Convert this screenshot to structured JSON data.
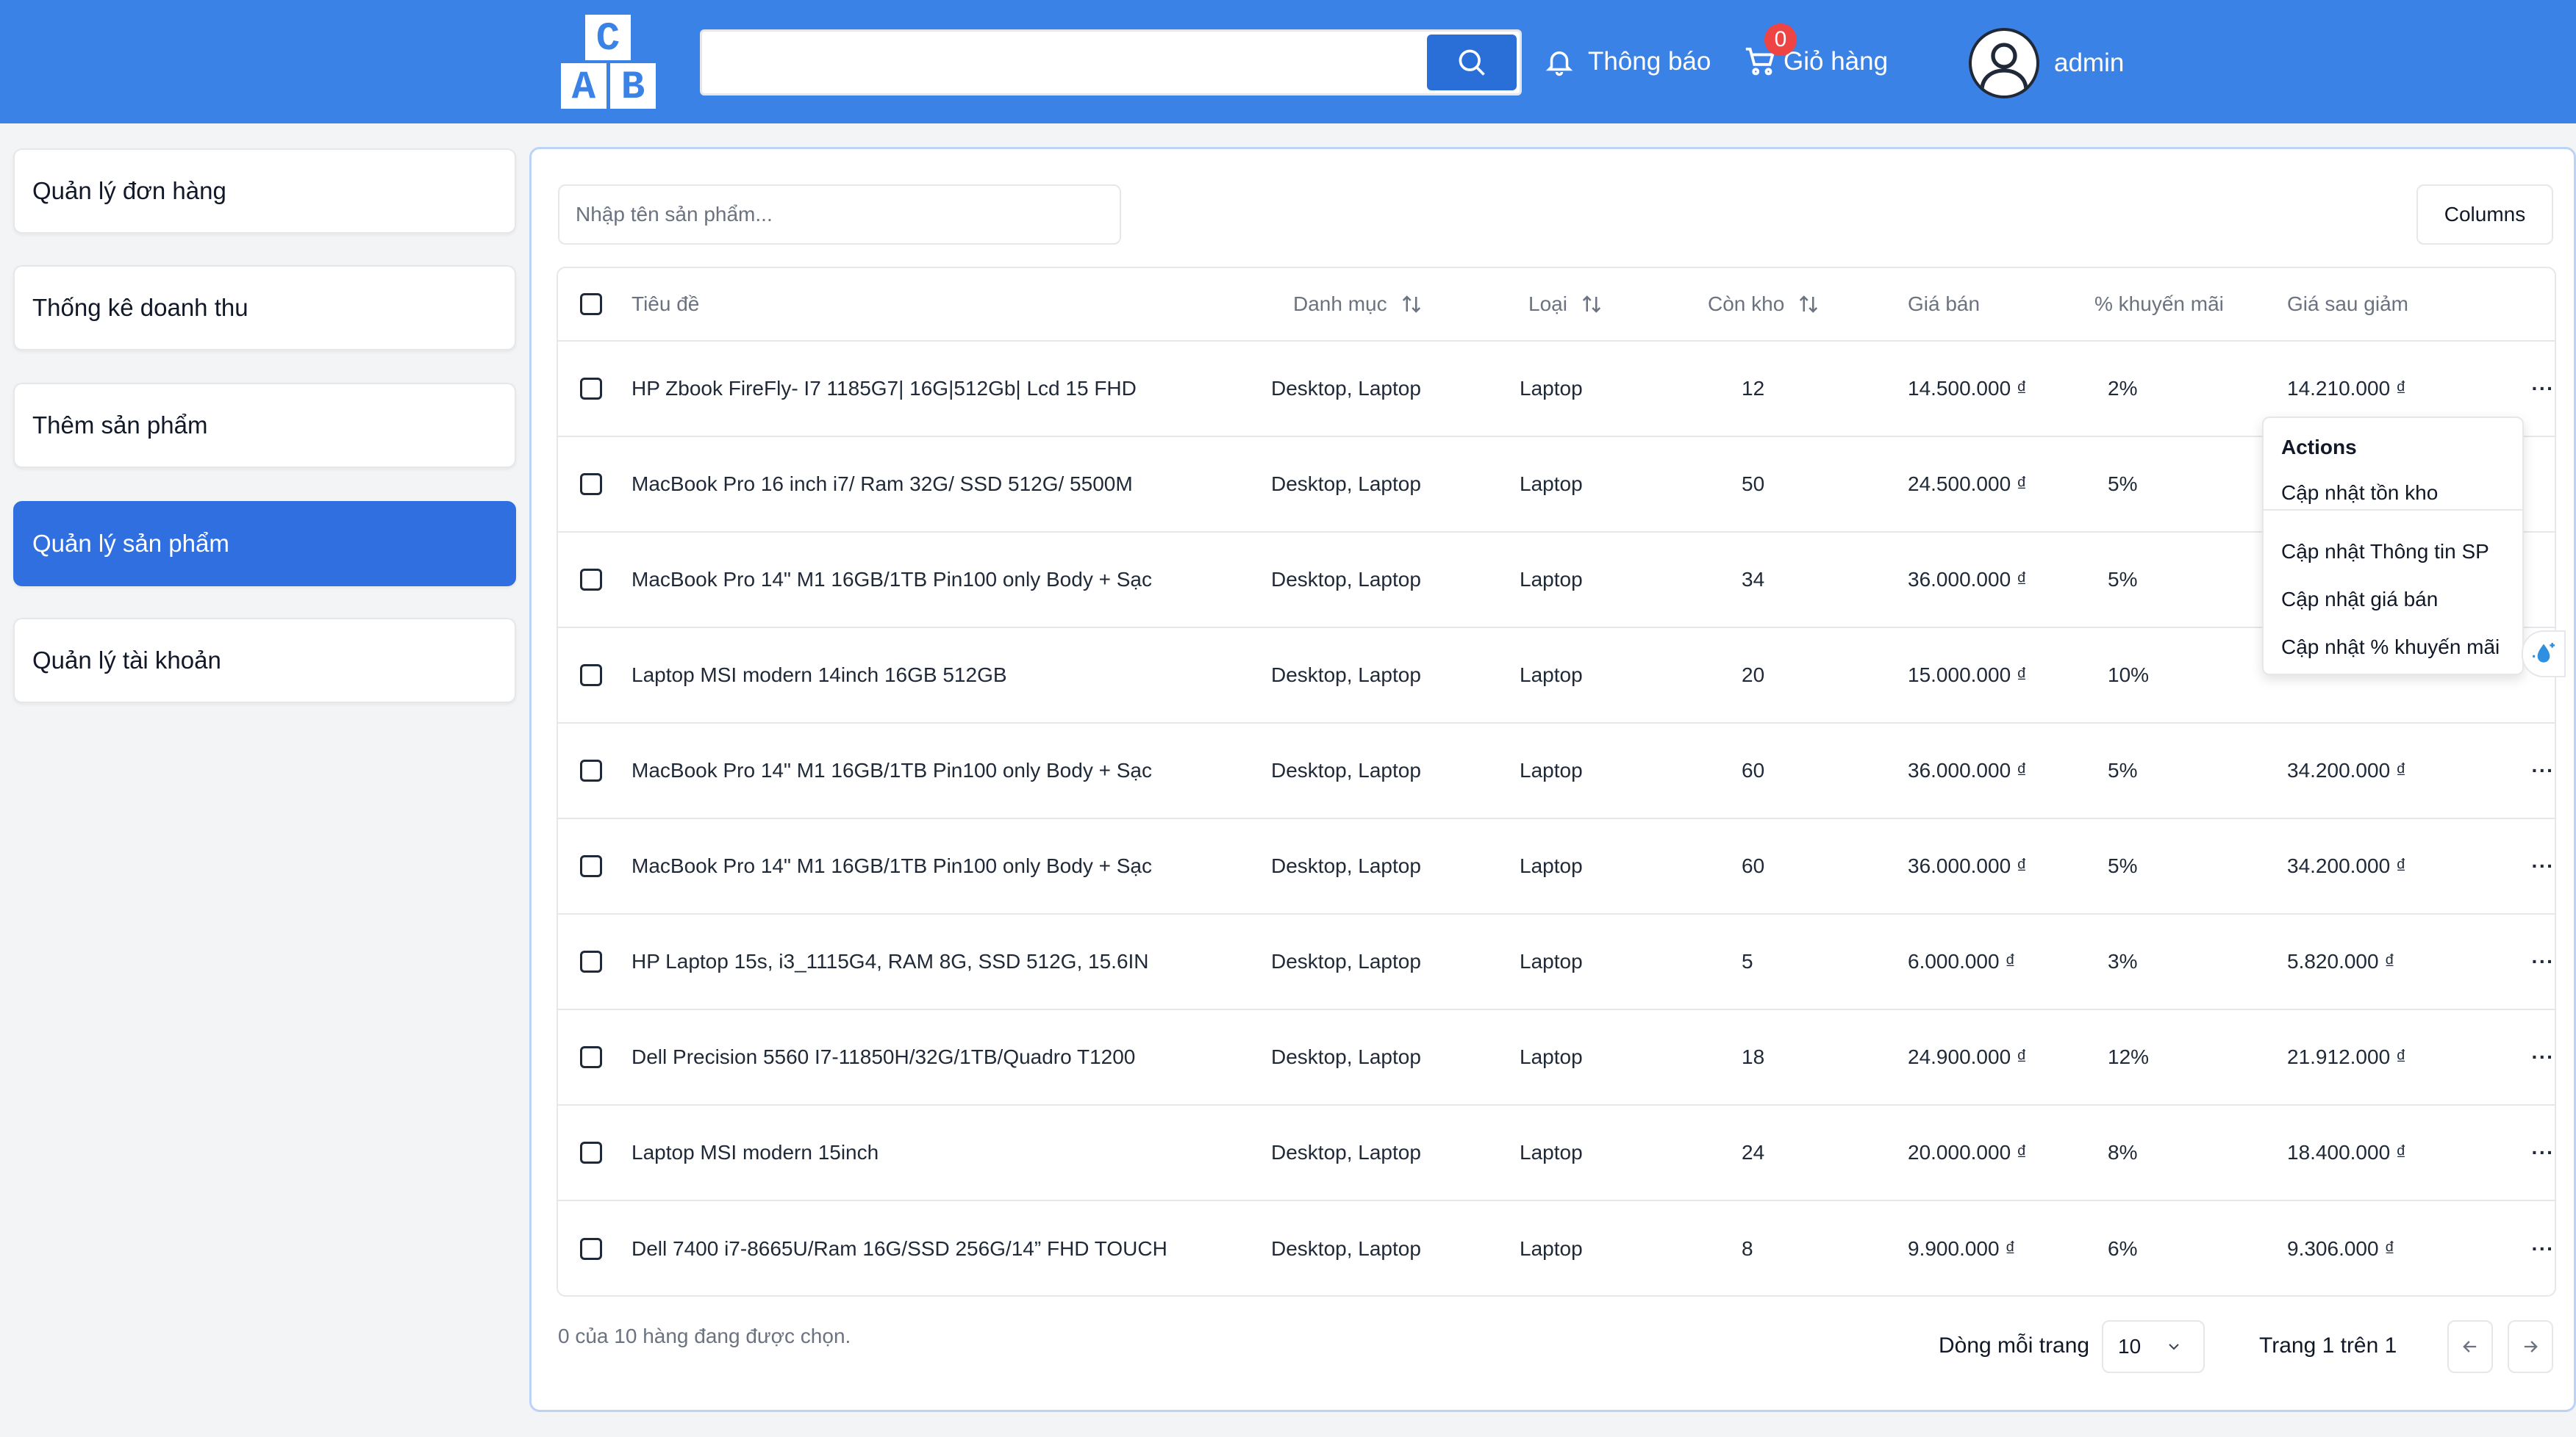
{
  "header": {
    "logo_letters": [
      "C",
      "A",
      "B"
    ],
    "search_value": "",
    "notifications_label": "Thông báo",
    "cart_label": "Giỏ hàng",
    "cart_count": "0",
    "username": "admin",
    "brand_color": "#3b82e6"
  },
  "sidebar": {
    "items": [
      {
        "label": "Quản lý đơn hàng",
        "active": false
      },
      {
        "label": "Thống kê doanh thu",
        "active": false
      },
      {
        "label": "Thêm sản phẩm",
        "active": false
      },
      {
        "label": "Quản lý sản phẩm",
        "active": true
      },
      {
        "label": "Quản lý tài khoản",
        "active": false
      }
    ]
  },
  "main": {
    "filter_placeholder": "Nhập tên sản phẩm...",
    "columns_label": "Columns",
    "table": {
      "headers": {
        "title": "Tiêu đề",
        "category": "Danh mục",
        "type": "Loại",
        "stock": "Còn kho",
        "price": "Giá bán",
        "discount": "% khuyến mãi",
        "final_price": "Giá sau giảm"
      },
      "rows": [
        {
          "title": "HP Zbook FireFly- I7 1185G7| 16G|512Gb| Lcd 15 FHD",
          "category": "Desktop, Laptop",
          "type": "Laptop",
          "stock": "12",
          "price": "14.500.000 ₫",
          "discount": "2%",
          "final_price": "14.210.000 ₫"
        },
        {
          "title": "MacBook Pro 16 inch i7/ Ram 32G/ SSD 512G/ 5500M",
          "category": "Desktop, Laptop",
          "type": "Laptop",
          "stock": "50",
          "price": "24.500.000 ₫",
          "discount": "5%",
          "final_price": ""
        },
        {
          "title": "MacBook Pro 14\" M1 16GB/1TB Pin100 only Body + Sạc",
          "category": "Desktop, Laptop",
          "type": "Laptop",
          "stock": "34",
          "price": "36.000.000 ₫",
          "discount": "5%",
          "final_price": ""
        },
        {
          "title": "Laptop MSI modern 14inch 16GB 512GB",
          "category": "Desktop, Laptop",
          "type": "Laptop",
          "stock": "20",
          "price": "15.000.000 ₫",
          "discount": "10%",
          "final_price": ""
        },
        {
          "title": "MacBook Pro 14\" M1 16GB/1TB Pin100 only Body + Sạc",
          "category": "Desktop, Laptop",
          "type": "Laptop",
          "stock": "60",
          "price": "36.000.000 ₫",
          "discount": "5%",
          "final_price": "34.200.000 ₫"
        },
        {
          "title": "MacBook Pro 14\" M1 16GB/1TB Pin100 only Body + Sạc",
          "category": "Desktop, Laptop",
          "type": "Laptop",
          "stock": "60",
          "price": "36.000.000 ₫",
          "discount": "5%",
          "final_price": "34.200.000 ₫"
        },
        {
          "title": "HP Laptop 15s, i3_1115G4, RAM 8G, SSD 512G, 15.6IN",
          "category": "Desktop, Laptop",
          "type": "Laptop",
          "stock": "5",
          "price": "6.000.000 ₫",
          "discount": "3%",
          "final_price": "5.820.000 ₫"
        },
        {
          "title": "Dell Precision 5560 I7-11850H/32G/1TB/Quadro T1200",
          "category": "Desktop, Laptop",
          "type": "Laptop",
          "stock": "18",
          "price": "24.900.000 ₫",
          "discount": "12%",
          "final_price": "21.912.000 ₫"
        },
        {
          "title": "Laptop MSI modern 15inch",
          "category": "Desktop, Laptop",
          "type": "Laptop",
          "stock": "24",
          "price": "20.000.000 ₫",
          "discount": "8%",
          "final_price": "18.400.000 ₫"
        },
        {
          "title": "Dell 7400 i7-8665U/Ram 16G/SSD 256G/14” FHD TOUCH",
          "category": "Desktop, Laptop",
          "type": "Laptop",
          "stock": "8",
          "price": "9.900.000 ₫",
          "discount": "6%",
          "final_price": "9.306.000 ₫"
        }
      ]
    },
    "actions_menu": {
      "title": "Actions",
      "items": [
        "Cập nhật tồn kho",
        "Cập nhật Thông tin SP",
        "Cập nhật giá bán",
        "Cập nhật % khuyến mãi"
      ]
    },
    "footer": {
      "selected_text": "0 của 10 hàng đang được chọn.",
      "rows_per_page_label": "Dòng mỗi trang",
      "rows_per_page_value": "10",
      "page_info": "Trang 1 trên 1"
    }
  }
}
